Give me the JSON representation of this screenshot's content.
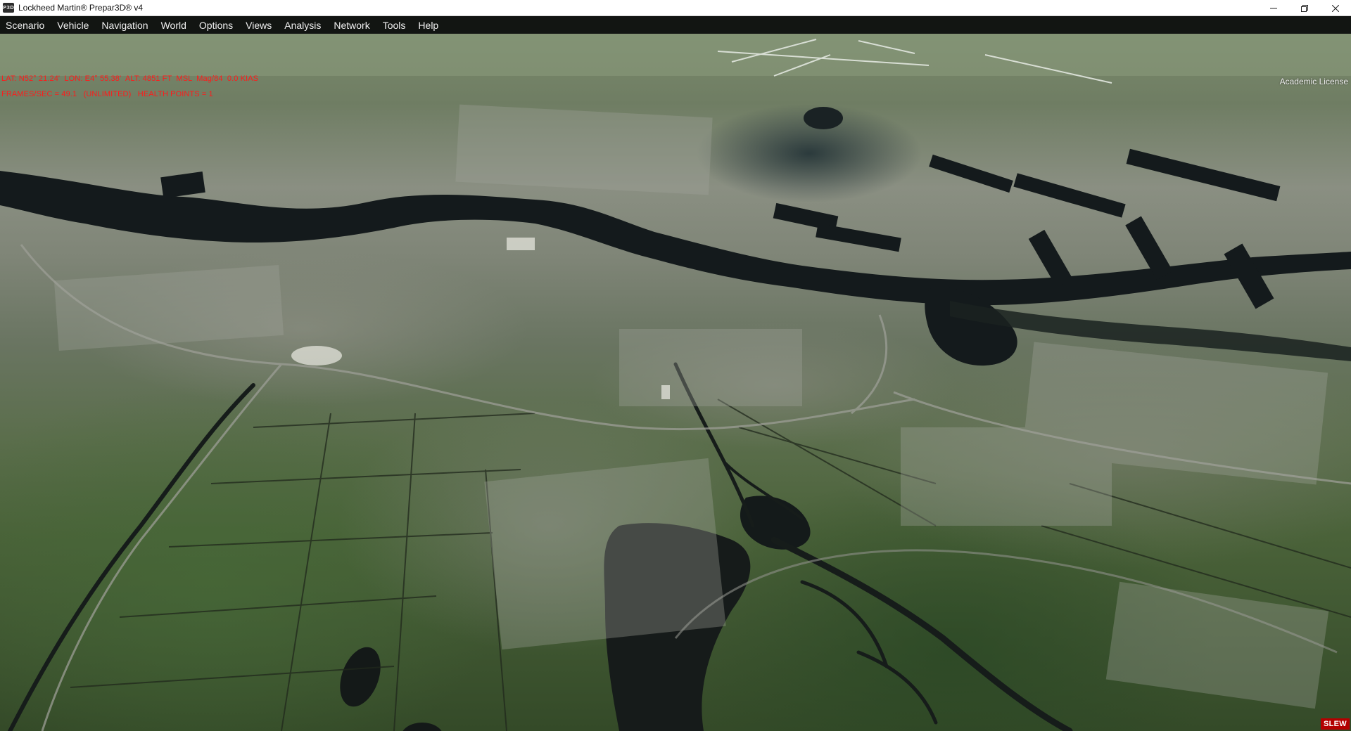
{
  "window": {
    "title": "Lockheed Martin® Prepar3D® v4",
    "icon": "p3d-app-icon",
    "icon_text": "P3D",
    "controls": {
      "minimize": "minimize-icon",
      "restore": "restore-icon",
      "close": "close-icon"
    }
  },
  "menu": {
    "items": [
      {
        "id": "scenario",
        "label": "Scenario"
      },
      {
        "id": "vehicle",
        "label": "Vehicle"
      },
      {
        "id": "navigation",
        "label": "Navigation"
      },
      {
        "id": "world",
        "label": "World"
      },
      {
        "id": "options",
        "label": "Options"
      },
      {
        "id": "views",
        "label": "Views"
      },
      {
        "id": "analysis",
        "label": "Analysis"
      },
      {
        "id": "network",
        "label": "Network"
      },
      {
        "id": "tools",
        "label": "Tools"
      },
      {
        "id": "help",
        "label": "Help"
      }
    ]
  },
  "viewport": {
    "hud_line1": "LAT: N52° 21.24'  LON: E4° 55.38'  ALT: 4851 FT  MSL  Mag/84  0.0 KIAS",
    "hud_line2": "FRAMES/SEC = 49.1   (UNLIMITED)   HEALTH POINTS = 1",
    "license": "Academic License",
    "slew_badge": "SLEW",
    "colors": {
      "hud_text": "#ff1a1a",
      "slew_bg": "#b30000",
      "water": "#141a1c",
      "field_green": "#4f6b3a"
    }
  }
}
